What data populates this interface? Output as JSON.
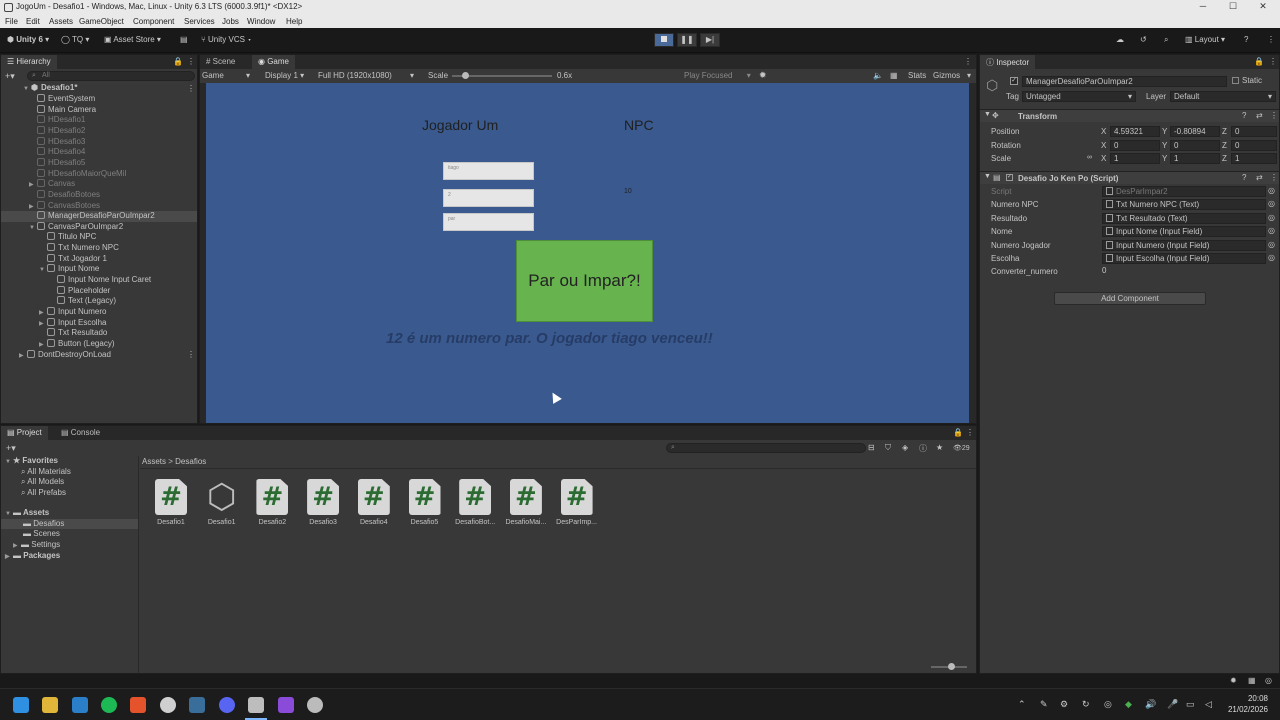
{
  "window": {
    "title": "JogoUm - Desafio1 - Windows, Mac, Linux - Unity 6.3 LTS (6000.3.9f1)* <DX12>",
    "minimize": "─",
    "maximize": "☐",
    "close": "✕"
  },
  "menu": [
    "File",
    "Edit",
    "Assets",
    "GameObject",
    "Component",
    "Services",
    "Jobs",
    "Window",
    "Help"
  ],
  "toolbar": {
    "unity": "Unity 6",
    "account": "TQ",
    "asset_store": "Asset Store",
    "vcs": "Unity VCS",
    "layout": "Layout"
  },
  "hierarchy": {
    "tab": "Hierarchy",
    "search_placeholder": "All",
    "scene": "Desafio1*",
    "items": [
      {
        "label": "EventSystem",
        "indent": 2,
        "dim": false,
        "arrow": ""
      },
      {
        "label": "Main Camera",
        "indent": 2,
        "dim": false,
        "arrow": ""
      },
      {
        "label": "HDesafio1",
        "indent": 2,
        "dim": true,
        "arrow": ""
      },
      {
        "label": "HDesafio2",
        "indent": 2,
        "dim": true,
        "arrow": ""
      },
      {
        "label": "HDesafio3",
        "indent": 2,
        "dim": true,
        "arrow": ""
      },
      {
        "label": "HDesafio4",
        "indent": 2,
        "dim": true,
        "arrow": ""
      },
      {
        "label": "HDesafio5",
        "indent": 2,
        "dim": true,
        "arrow": ""
      },
      {
        "label": "HDesafioMaiorQueMil",
        "indent": 2,
        "dim": true,
        "arrow": ""
      },
      {
        "label": "Canvas",
        "indent": 2,
        "dim": true,
        "arrow": "▶"
      },
      {
        "label": "DesafioBotoes",
        "indent": 2,
        "dim": true,
        "arrow": ""
      },
      {
        "label": "CanvasBotoes",
        "indent": 2,
        "dim": true,
        "arrow": "▶"
      },
      {
        "label": "ManagerDesafioParOuImpar2",
        "indent": 2,
        "dim": false,
        "arrow": "",
        "selected": true
      },
      {
        "label": "CanvasParOuImpar2",
        "indent": 2,
        "dim": false,
        "arrow": "▼"
      },
      {
        "label": "Titulo NPC",
        "indent": 3,
        "dim": false,
        "arrow": ""
      },
      {
        "label": "Txt Numero NPC",
        "indent": 3,
        "dim": false,
        "arrow": ""
      },
      {
        "label": "Txt Jogador 1",
        "indent": 3,
        "dim": false,
        "arrow": ""
      },
      {
        "label": "Input Nome",
        "indent": 3,
        "dim": false,
        "arrow": "▼"
      },
      {
        "label": "Input Nome Input Caret",
        "indent": 4,
        "dim": false,
        "arrow": ""
      },
      {
        "label": "Placeholder",
        "indent": 4,
        "dim": false,
        "arrow": ""
      },
      {
        "label": "Text (Legacy)",
        "indent": 4,
        "dim": false,
        "arrow": ""
      },
      {
        "label": "Input Numero",
        "indent": 3,
        "dim": false,
        "arrow": "▶"
      },
      {
        "label": "Input Escolha",
        "indent": 3,
        "dim": false,
        "arrow": "▶"
      },
      {
        "label": "Txt Resultado",
        "indent": 3,
        "dim": false,
        "arrow": ""
      },
      {
        "label": "Button (Legacy)",
        "indent": 3,
        "dim": false,
        "arrow": "▶"
      },
      {
        "label": "DontDestroyOnLoad",
        "indent": 1,
        "dim": false,
        "arrow": "▶"
      }
    ]
  },
  "center_tabs": {
    "scene": "Scene",
    "game": "Game"
  },
  "game_toolbar": {
    "mode": "Game",
    "display": "Display 1",
    "resolution": "Full HD (1920x1080)",
    "scale_label": "Scale",
    "scale_value": "0.6x",
    "play_focused": "Play Focused",
    "stats": "Stats",
    "gizmos": "Gizmos"
  },
  "game": {
    "jogador_label": "Jogador Um",
    "npc_label": "NPC",
    "input_nome": "tiago",
    "input_numero": "2",
    "input_escolha": "par",
    "npc_number": "10",
    "button": "Par ou Impar?!",
    "result": "12 é um numero par. O jogador tiago venceu!!",
    "bg_color": "#3a5a8f",
    "button_color": "#67b34e"
  },
  "inspector": {
    "tab": "Inspector",
    "object_name": "ManagerDesafioParOuImpar2",
    "static": "Static",
    "tag_label": "Tag",
    "tag_value": "Untagged",
    "layer_label": "Layer",
    "layer_value": "Default",
    "transform": {
      "title": "Transform",
      "position_label": "Position",
      "position": {
        "x": "4.59321",
        "y": "-0.80894",
        "z": "0"
      },
      "rotation_label": "Rotation",
      "rotation": {
        "x": "0",
        "y": "0",
        "z": "0"
      },
      "scale_label": "Scale",
      "scale": {
        "x": "1",
        "y": "1",
        "z": "1"
      }
    },
    "script": {
      "title": "Desafio Jo Ken Po (Script)",
      "fields": [
        {
          "label": "Script",
          "value": "DesParImpar2",
          "dim": true
        },
        {
          "label": "Numero NPC",
          "value": "Txt Numero NPC (Text)",
          "dim": false
        },
        {
          "label": "Resultado",
          "value": "Txt Resultado (Text)",
          "dim": false
        },
        {
          "label": "Nome",
          "value": "Input Nome (Input Field)",
          "dim": false
        },
        {
          "label": "Numero Jogador",
          "value": "Input Numero (Input Field)",
          "dim": false
        },
        {
          "label": "Escolha",
          "value": "Input Escolha (Input Field)",
          "dim": false
        },
        {
          "label": "Converter_numero",
          "value": "0",
          "dim": false
        }
      ]
    },
    "add_component": "Add Component"
  },
  "project": {
    "tab": "Project",
    "console_tab": "Console",
    "hidden_count": "29",
    "favorites": "Favorites",
    "fav_items": [
      "All Materials",
      "All Models",
      "All Prefabs"
    ],
    "assets": "Assets",
    "asset_folders": [
      "Desafios",
      "Scenes",
      "Settings"
    ],
    "packages": "Packages",
    "breadcrumb_root": "Assets",
    "breadcrumb_sep": ">",
    "breadcrumb_current": "Desafios",
    "files": [
      {
        "name": "Desafio1",
        "type": "script"
      },
      {
        "name": "Desafio1",
        "type": "scene"
      },
      {
        "name": "Desafio2",
        "type": "script"
      },
      {
        "name": "Desafio3",
        "type": "script"
      },
      {
        "name": "Desafio4",
        "type": "script"
      },
      {
        "name": "Desafio5",
        "type": "script"
      },
      {
        "name": "DesafioBot...",
        "type": "script"
      },
      {
        "name": "DesafioMai...",
        "type": "script"
      },
      {
        "name": "DesParImp...",
        "type": "script"
      }
    ]
  },
  "taskbar": {
    "time": "20:08",
    "date": "21/02/2026"
  }
}
